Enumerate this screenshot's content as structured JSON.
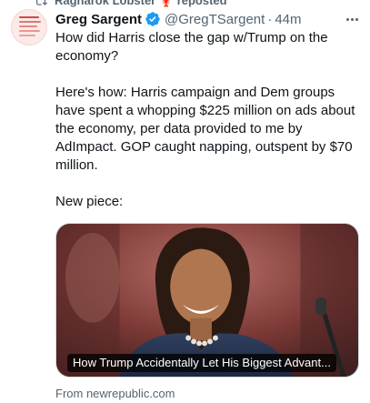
{
  "repost": {
    "user": "Ragnarok Lobster",
    "emoji": "🦞",
    "verb": "reposted",
    "icon": "repost-icon"
  },
  "avatar": {
    "icon": "avatar",
    "colors": [
      "#fbeae6",
      "#d24848"
    ]
  },
  "author": {
    "display_name": "Greg Sargent",
    "handle": "@GregTSargent",
    "separator": "·",
    "time": "44m",
    "verified_icon": "verified-badge-icon",
    "verified_color": "#1d9bf0"
  },
  "more_icon": "more-icon",
  "tweet": {
    "paragraphs": [
      "How did Harris close the gap w/Trump on the economy?",
      "Here's how: Harris campaign and Dem groups have spent a whopping $225 million on ads about the economy, per data provided to me by AdImpact. GOP caught napping, outspent by $70 million.",
      "New piece:"
    ]
  },
  "card": {
    "title": "How Trump Accidentally Let His Biggest Advant...",
    "source": "From newrepublic.com"
  },
  "colors": {
    "text": "#0f1419",
    "secondary": "#536471",
    "border": "#cfd9de"
  }
}
